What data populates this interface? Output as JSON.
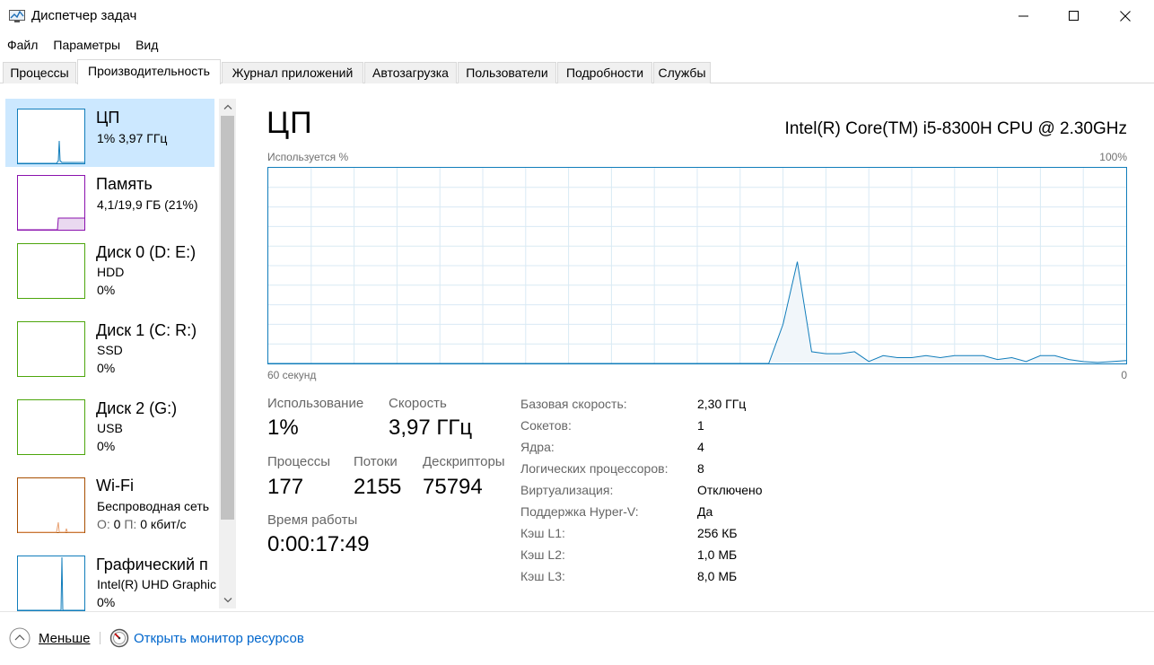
{
  "window": {
    "title": "Диспетчер задач"
  },
  "menu": [
    "Файл",
    "Параметры",
    "Вид"
  ],
  "tabs": [
    "Процессы",
    "Производительность",
    "Журнал приложений",
    "Автозагрузка",
    "Пользователи",
    "Подробности",
    "Службы"
  ],
  "active_tab": "Производительность",
  "sidebar": {
    "items": [
      {
        "name": "ЦП",
        "line1": "1%  3,97 ГГц",
        "line2": "",
        "color": "#117dbb",
        "selected": true,
        "icon": "cpu-thumbnail"
      },
      {
        "name": "Память",
        "line1": "4,1/19,9 ГБ (21%)",
        "line2": "",
        "color": "#8b12ae",
        "selected": false,
        "icon": "memory-thumbnail"
      },
      {
        "name": "Диск 0 (D: E:)",
        "line1": "HDD",
        "line2": "0%",
        "color": "#4da60c",
        "selected": false,
        "icon": "disk-thumbnail"
      },
      {
        "name": "Диск 1 (C: R:)",
        "line1": "SSD",
        "line2": "0%",
        "color": "#4da60c",
        "selected": false,
        "icon": "disk-thumbnail"
      },
      {
        "name": "Диск 2 (G:)",
        "line1": "USB",
        "line2": "0%",
        "color": "#4da60c",
        "selected": false,
        "icon": "disk-thumbnail"
      },
      {
        "name": "Wi-Fi",
        "line1": "Беспроводная сеть",
        "line2_send_label": "О:",
        "line2_send": "0",
        "line2_recv_label": "П:",
        "line2_recv": "0 кбит/с",
        "color": "#a74f01",
        "selected": false,
        "icon": "network-thumbnail"
      },
      {
        "name": "Графический п",
        "line1": "Intel(R) UHD Graphic",
        "line2": "0%",
        "color": "#117dbb",
        "selected": false,
        "icon": "gpu-thumbnail"
      }
    ]
  },
  "cpu": {
    "heading": "ЦП",
    "model": "Intel(R) Core(TM) i5-8300H CPU @ 2.30GHz",
    "graph_label_left": "Используется %",
    "graph_label_right": "100%",
    "graph_bottom_left": "60 секунд",
    "graph_bottom_right": "0",
    "graph_color": "#117dbb",
    "usage_history_percent": [
      0,
      0,
      0,
      0,
      0,
      0,
      0,
      0,
      0,
      0,
      0,
      0,
      0,
      0,
      0,
      0,
      0,
      0,
      0,
      0,
      0,
      0,
      0,
      0,
      0,
      0,
      0,
      0,
      0,
      0,
      0,
      0,
      0,
      0,
      0,
      0,
      20,
      52,
      6,
      5,
      5,
      6,
      1,
      4,
      3,
      3,
      4,
      3,
      4,
      4,
      4,
      2,
      3,
      1,
      4,
      4,
      2,
      1,
      0.5,
      1,
      1.5
    ],
    "stats": {
      "usage_label": "Использование",
      "usage_value": "1%",
      "speed_label": "Скорость",
      "speed_value": "3,97 ГГц",
      "processes_label": "Процессы",
      "processes_value": "177",
      "threads_label": "Потоки",
      "threads_value": "2155",
      "handles_label": "Дескрипторы",
      "handles_value": "75794",
      "uptime_label": "Время работы",
      "uptime_value": "0:00:17:49"
    },
    "info": [
      {
        "label": "Базовая скорость:",
        "value": "2,30 ГГц"
      },
      {
        "label": "Сокетов:",
        "value": "1"
      },
      {
        "label": "Ядра:",
        "value": "4"
      },
      {
        "label": "Логических процессоров:",
        "value": "8"
      },
      {
        "label": "Виртуализация:",
        "value": "Отключено"
      },
      {
        "label": "Поддержка Hyper-V:",
        "value": "Да"
      },
      {
        "label": "Кэш L1:",
        "value": "256 КБ"
      },
      {
        "label": "Кэш L2:",
        "value": "1,0 МБ"
      },
      {
        "label": "Кэш L3:",
        "value": "8,0 МБ"
      }
    ]
  },
  "bottom": {
    "less_label": "Меньше",
    "monitor_label": "Открыть монитор ресурсов"
  }
}
